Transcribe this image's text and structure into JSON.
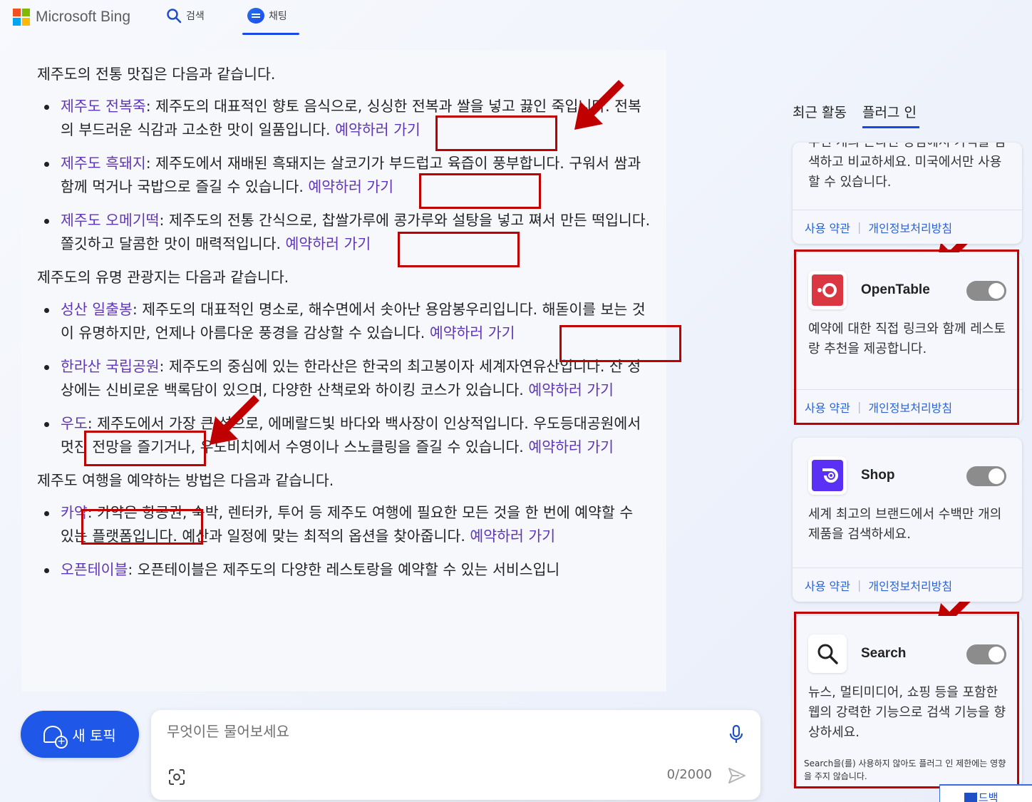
{
  "header": {
    "logo_text": "Microsoft Bing",
    "nav_search": "검색",
    "nav_chat": "채팅"
  },
  "chat": {
    "intro_restaurants": "제주도의 전통 맛집은 다음과 같습니다.",
    "restaurants": [
      {
        "term": "제주도 전복죽",
        "text": ": 제주도의 대표적인 향토 음식으로, 싱싱한 전복과 쌀을 넣고 끓인 죽입니다. 전복의 부드러운 식감과 고소한 맛이 일품입니다.",
        "link": "예약하러 가기"
      },
      {
        "term": "제주도 흑돼지",
        "text": ": 제주도에서 재배된 흑돼지는 살코기가 부드럽고 육즙이 풍부합니다. 구워서 쌈과 함께 먹거나 국밥으로 즐길 수 있습니다.",
        "link": "예약하러 가기"
      },
      {
        "term": "제주도 오메기떡",
        "text": ": 제주도의 전통 간식으로, 찹쌀가루에 콩가루와 설탕을 넣고 쪄서 만든 떡입니다. 쫄깃하고 달콤한 맛이 매력적입니다.",
        "link": "예약하러 가기"
      }
    ],
    "intro_sights": "제주도의 유명 관광지는 다음과 같습니다.",
    "sights": [
      {
        "term": "성산 일출봉",
        "text": ": 제주도의 대표적인 명소로, 해수면에서 솟아난 용암봉우리입니다. 해돋이를 보는 것이 유명하지만, 언제나 아름다운 풍경을 감상할 수 있습니다.",
        "link": "예약하러 가기"
      },
      {
        "term": "한라산 국립공원",
        "text": ": 제주도의 중심에 있는 한라산은 한국의 최고봉이자 세계자연유산입니다. 산 정상에는 신비로운 백록담이 있으며, 다양한 산책로와 하이킹 코스가 있습니다.",
        "link": "예약하러 가기"
      },
      {
        "term": "우도",
        "text": ": 제주도에서 가장 큰 섬으로, 에메랄드빛 바다와 백사장이 인상적입니다. 우도등대공원에서 멋진 전망을 즐기거나, 우도비치에서 수영이나 스노클링을 즐길 수 있습니다.",
        "link": "예약하러 가기"
      }
    ],
    "intro_booking": "제주도 여행을 예약하는 방법은 다음과 같습니다.",
    "booking": [
      {
        "term": "카약",
        "text": ": 카약은 항공권, 숙박, 렌터카, 투어 등 제주도 여행에 필요한 모든 것을 한 번에 예약할 수 있는 플랫폼입니다. 예산과 일정에 맞는 최적의 옵션을 찾아줍니다.",
        "link": "예약하러 가기"
      },
      {
        "term": "오픈테이블",
        "text": ": 오픈테이블은 제주도의 다양한 레스토랑을 예약할 수 있는 서비스입니",
        "link": ""
      }
    ]
  },
  "composer": {
    "new_topic": "새 토픽",
    "placeholder": "무엇이든 물어보세요",
    "counter": "0/2000"
  },
  "sidebar": {
    "tab_recent": "최근 활동",
    "tab_plugins": "플러그 인",
    "partial_card_desc": "수천 개의 온라인 상점에서 가격을 검색하고 비교하세요. 미국에서만 사용할 수 있습니다.",
    "terms": "사용 약관",
    "privacy": "개인정보처리방침",
    "plugins": [
      {
        "name": "OpenTable",
        "desc": "예약에 대한 직접 링크와 함께 레스토랑 추천을 제공합니다."
      },
      {
        "name": "Shop",
        "desc": "세계 최고의 브랜드에서 수백만 개의 제품을 검색하세요."
      },
      {
        "name": "Search",
        "desc": "뉴스, 멀티미디어, 쇼핑 등을 포함한 웹의 강력한 기능으로 검색 기능을 향상하세요.",
        "note": "Search을(를) 사용하지 않아도 플러그 인 제한에는 영향을 주지 않습니다."
      }
    ],
    "corner_label": "피드백"
  },
  "colors": {
    "accent_blue": "#174ae4",
    "link_purple": "#5f36b8",
    "annotation_red": "#c00000",
    "opentable_red": "#da3743",
    "shop_purple": "#5a31f4"
  }
}
